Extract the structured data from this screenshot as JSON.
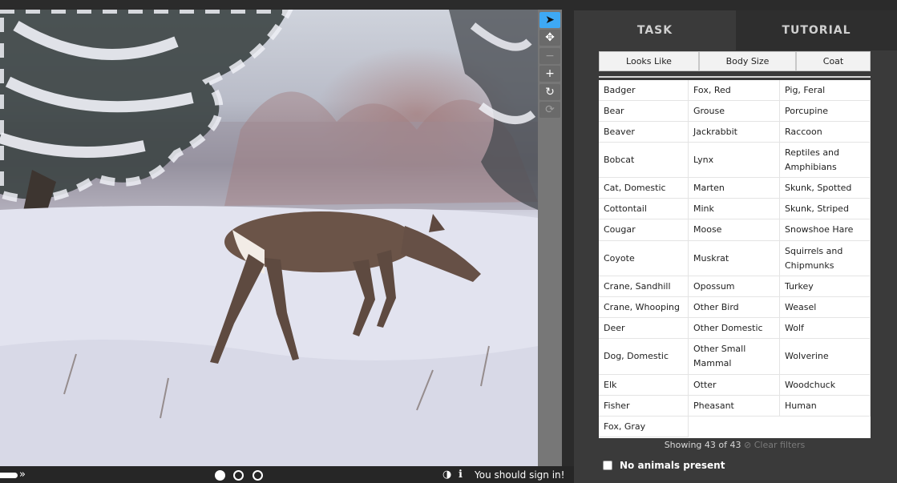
{
  "viewer": {
    "toolbar": {
      "items": [
        {
          "name": "pointer-tool",
          "icon": "arrow-pointer-icon",
          "glyph": "➤",
          "state": "active"
        },
        {
          "name": "move-tool",
          "icon": "move-arrows-icon",
          "glyph": "✥",
          "state": "normal"
        },
        {
          "name": "zoom-out-tool",
          "icon": "minus-icon",
          "glyph": "−",
          "state": "disabled"
        },
        {
          "name": "zoom-in-tool",
          "icon": "plus-icon",
          "glyph": "+",
          "state": "normal"
        },
        {
          "name": "rotate-tool",
          "icon": "rotate-icon",
          "glyph": "↻",
          "state": "normal"
        },
        {
          "name": "reset-tool",
          "icon": "refresh-icon",
          "glyph": "⟳",
          "state": "disabled"
        }
      ]
    },
    "player": {
      "fast_forward_glyph": "»",
      "frames_current": 1,
      "frames_total": 3
    },
    "invert_glyph": "◑",
    "info_glyph": "ℹ",
    "signin_message": "You should sign in!"
  },
  "panel": {
    "tabs": {
      "task": "TASK",
      "tutorial": "TUTORIAL"
    },
    "filters": [
      "Looks Like",
      "Body Size",
      "Coat"
    ],
    "choices_columns": [
      [
        "Badger",
        "Bear",
        "Beaver",
        "Bobcat",
        "Cat, Domestic",
        "Cottontail",
        "Cougar",
        "Coyote",
        "Crane, Sandhill",
        "Crane, Whooping",
        "Deer",
        "Dog, Domestic",
        "Elk",
        "Fisher",
        "Fox, Gray"
      ],
      [
        "Fox, Red",
        "Grouse",
        "Jackrabbit",
        "Lynx",
        "Marten",
        "Mink",
        "Moose",
        "Muskrat",
        "Opossum",
        "Other Bird",
        "Other Domestic",
        "Other Small Mammal",
        "Otter",
        "Pheasant"
      ],
      [
        "Pig, Feral",
        "Porcupine",
        "Raccoon",
        "Reptiles and Amphibians",
        "Skunk, Spotted",
        "Skunk, Striped",
        "Snowshoe Hare",
        "Squirrels and Chipmunks",
        "Turkey",
        "Weasel",
        "Wolf",
        "Wolverine",
        "Woodchuck",
        "Human"
      ]
    ],
    "showing_text": "Showing 43 of 43",
    "clear_filters": "Clear filters",
    "clear_icon_glyph": "⊘",
    "no_animals_label": "No animals present"
  },
  "colors": {
    "accent": "#3ea9f5",
    "panel_bg": "#3a3a3a",
    "tab_inactive_bg": "#2e2e2e"
  }
}
